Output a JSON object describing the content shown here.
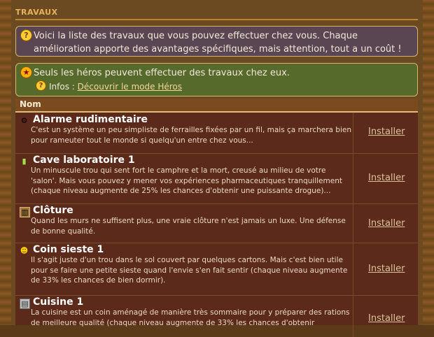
{
  "section": {
    "title": "TRAVAUX"
  },
  "info_note": {
    "text": "Voici la liste des travaux que vous pouvez effectuer chez vous. Chaque amélioration apporte des avantages spécifiques, mais attention, tout a un coût !"
  },
  "hero_note": {
    "text": "Seuls les héros peuvent effectuer des travaux chez eux.",
    "infos_label": "Infos :",
    "link_text": "Découvrir le mode Héros"
  },
  "table": {
    "header": "Nom",
    "rows": [
      {
        "name": "Alarme rudimentaire",
        "icon": "alarm-icon",
        "desc": "C'est un système un peu simpliste de ferrailles fixées par un fil, mais ça marchera bien pour rameuter tout le monde si quelqu'un entre chez vous...",
        "action": "Installer"
      },
      {
        "name": "Cave laboratoire 1",
        "icon": "flask-icon",
        "desc": "Un minuscule trou qui sent fort le camphre et la mort, creusé au milieu de votre 'salon'. Mais vous pouvez y mener vos expériences pharmaceutiques tranquillement (chaque niveau augmente de 25% les chances d'obtenir une puissante drogue)...",
        "action": "Installer"
      },
      {
        "name": "Clôture",
        "icon": "fence-icon",
        "desc": "Quand les murs ne suffisent plus, une vraie clôture n'est jamais un luxe. Une défense de bonne qualité.",
        "action": "Installer"
      },
      {
        "name": "Coin sieste 1",
        "icon": "bed-icon",
        "desc": "Il s'agit juste d'un trou dans le sol couvert par quelques cartons. Mais c'est bien utile pour se faire une petite sieste quand l'envie s'en fait sentir (chaque niveau augmente de 33% les chances de bien dormir).",
        "action": "Installer"
      },
      {
        "name": "Cuisine 1",
        "icon": "kitchen-icon",
        "desc": "La cuisine est un coin aménagé de manière très sommaire pour y préparer des rations de meilleure qualité (chaque niveau augmente de 33% les chances d'obtenir",
        "action": "Installer"
      }
    ]
  }
}
